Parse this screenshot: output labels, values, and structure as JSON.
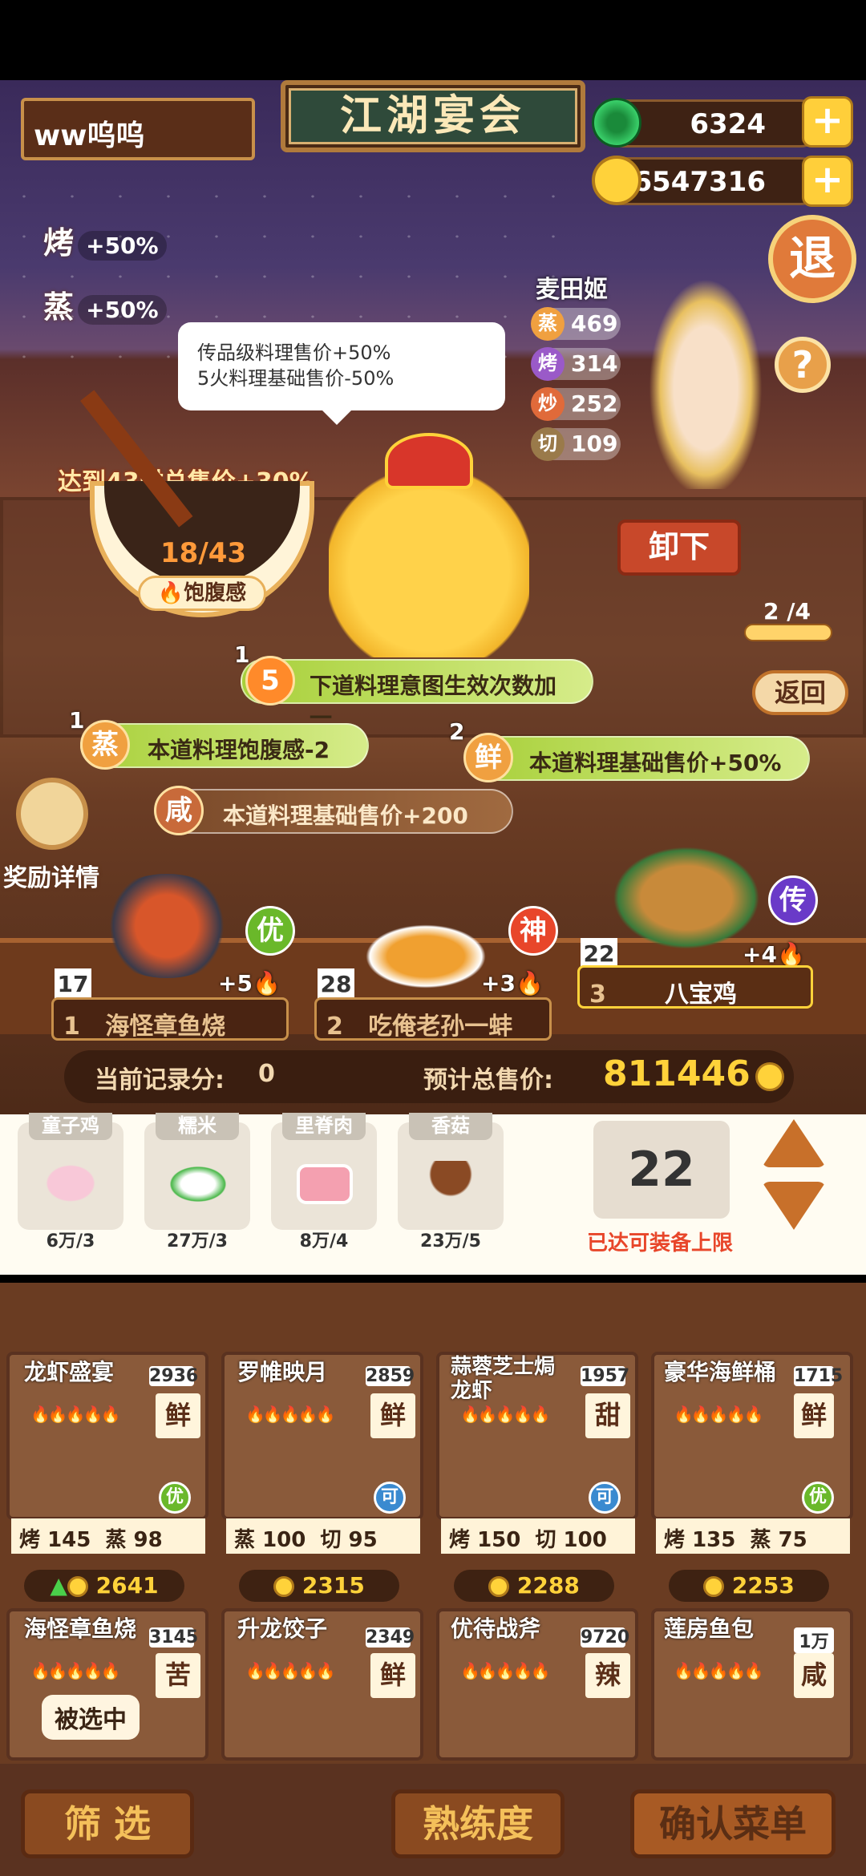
{
  "header": {
    "player_name": "ww呜呜",
    "event_title": "江湖宴会",
    "jade": "6324",
    "coins": "6547316",
    "exit_label": "退",
    "help_label": "?"
  },
  "bonuses": [
    {
      "label": "烤",
      "value": "+50%"
    },
    {
      "label": "蒸",
      "value": "+50%"
    }
  ],
  "bubble": [
    "传品级料理售价+50%",
    "5火料理基础售价-50%"
  ],
  "chef": {
    "name": "麦田姬",
    "stats": [
      {
        "icon": "蒸",
        "value": "469",
        "color": "#f0a040"
      },
      {
        "icon": "烤",
        "value": "314",
        "color": "#9a5ac8"
      },
      {
        "icon": "炒",
        "value": "252",
        "color": "#e06a3a"
      },
      {
        "icon": "切",
        "value": "109",
        "color": "#9a7a4a"
      }
    ]
  },
  "bowl": {
    "goal_text": "达到43时总售价+30%",
    "progress": "18/43",
    "label": "饱腹感"
  },
  "effects": [
    {
      "num": "1",
      "icon": "5",
      "text": "下道料理意图生效次数加一"
    },
    {
      "num": "1",
      "icon": "蒸",
      "text": "本道料理饱腹感-2"
    },
    {
      "num": "2",
      "icon": "鲜",
      "text": "本道料理基础售价+50%"
    },
    {
      "num": "",
      "icon": "咸",
      "text": "本道料理基础售价+200"
    }
  ],
  "controls": {
    "unload_label": "卸下",
    "slot_count": "2 /4",
    "back_label": "返回",
    "reward_label": "奖励详情"
  },
  "served": [
    {
      "slot": "1",
      "name": "海怪章鱼烧",
      "count": "17",
      "fire": "+5",
      "grade": "优",
      "grade_color": "#6ab82a"
    },
    {
      "slot": "2",
      "name": "吃俺老孙一蚌",
      "count": "28",
      "fire": "+3",
      "grade": "神",
      "grade_color": "#e8462a"
    },
    {
      "slot": "3",
      "name": "八宝鸡",
      "count": "22",
      "fire": "+4",
      "grade": "传",
      "grade_color": "#6a3ac8"
    }
  ],
  "score": {
    "record_label": "当前记录分:",
    "record_value": "0",
    "total_label": "预计总售价:",
    "total_value": "811446"
  },
  "ingredients": [
    {
      "name": "童子鸡",
      "price": "6万/3",
      "icon": "chicken-icon"
    },
    {
      "name": "糯米",
      "price": "27万/3",
      "icon": "rice-icon"
    },
    {
      "name": "里脊肉",
      "price": "8万/4",
      "icon": "meat-icon"
    },
    {
      "name": "香菇",
      "price": "23万/5",
      "icon": "mushroom-icon"
    }
  ],
  "capacity": {
    "value": "22",
    "note": "已达可装备上限"
  },
  "recipes": [
    {
      "name": "龙虾盛宴",
      "num": "2936",
      "flavor": "鲜",
      "grade": "优",
      "s1": "烤",
      "v1": "145",
      "s2": "蒸",
      "v2": "98",
      "price": "2641",
      "up": true
    },
    {
      "name": "罗帷映月",
      "num": "2859",
      "flavor": "鲜",
      "grade": "可",
      "s1": "蒸",
      "v1": "100",
      "s2": "切",
      "v2": "95",
      "price": "2315",
      "up": false
    },
    {
      "name": "蒜蓉芝士焗\n龙虾",
      "num": "1957",
      "flavor": "甜",
      "grade": "可",
      "s1": "烤",
      "v1": "150",
      "s2": "切",
      "v2": "100",
      "price": "2288",
      "up": false
    },
    {
      "name": "豪华海鲜桶",
      "num": "1715",
      "flavor": "鲜",
      "grade": "优",
      "s1": "烤",
      "v1": "135",
      "s2": "蒸",
      "v2": "75",
      "price": "2253",
      "up": false
    },
    {
      "name": "海怪章鱼烧",
      "num": "3145",
      "flavor": "苦",
      "selected": "被选中"
    },
    {
      "name": "升龙饺子",
      "num": "2349",
      "flavor": "鲜"
    },
    {
      "name": "优待战斧",
      "num": "9720",
      "flavor": "辣"
    },
    {
      "name": "莲房鱼包",
      "num": "1万",
      "flavor": "咸"
    }
  ],
  "bottom": {
    "filter": "筛 选",
    "proficiency": "熟练度",
    "confirm": "确认菜单"
  }
}
